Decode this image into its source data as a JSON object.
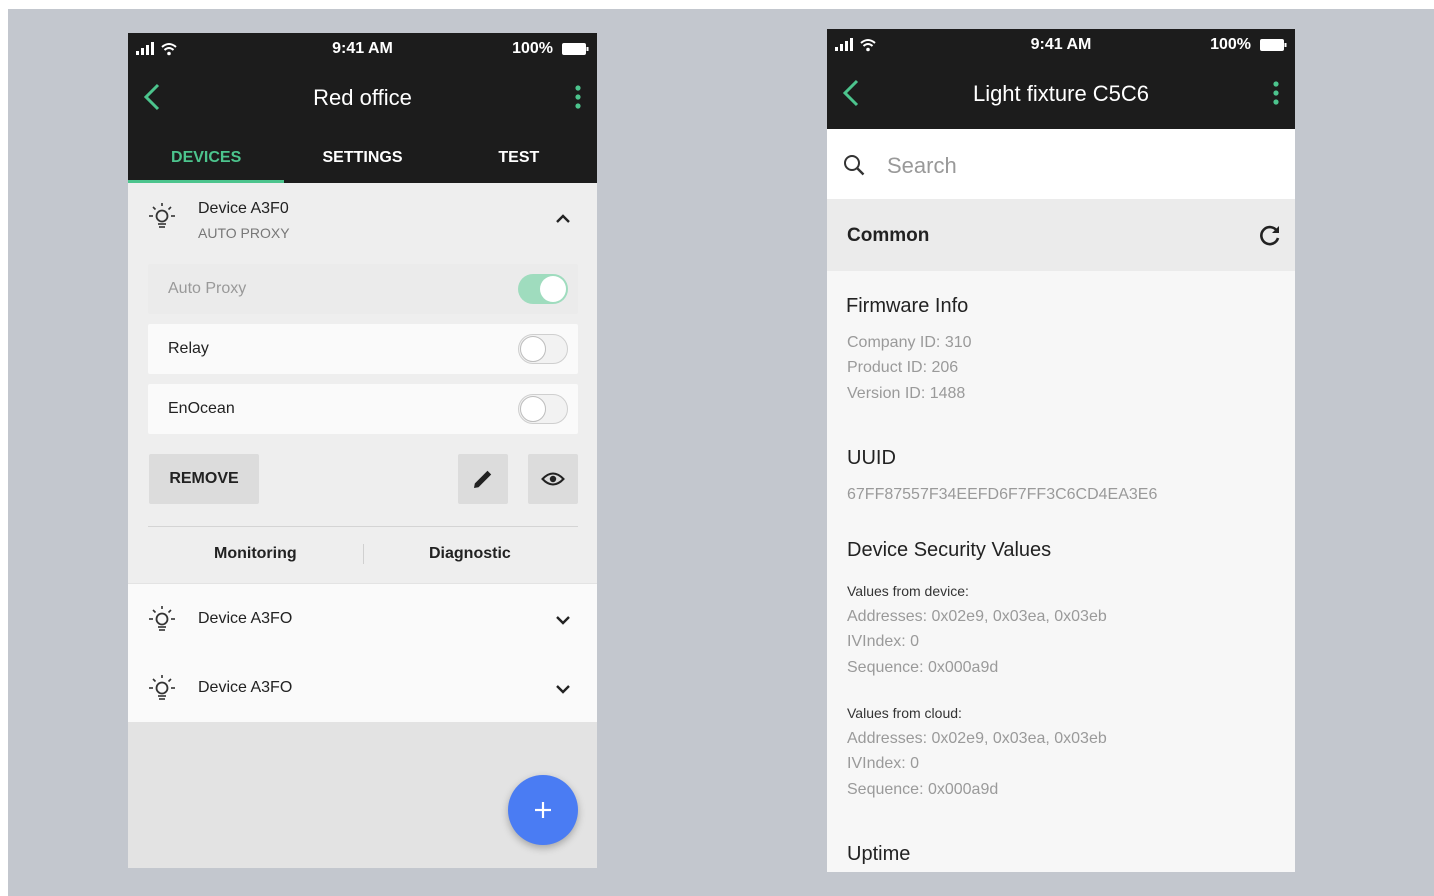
{
  "phone1": {
    "status": {
      "time": "9:41 AM",
      "battery": "100%"
    },
    "app_bar": {
      "title": "Red office"
    },
    "tabs": [
      {
        "label": "DEVICES",
        "active": true
      },
      {
        "label": "SETTINGS",
        "active": false
      },
      {
        "label": "TEST",
        "active": false
      }
    ],
    "expanded_device": {
      "name": "Device  A3F0",
      "subtitle": "AUTO PROXY",
      "toggles": [
        {
          "label": "Auto Proxy",
          "on": true,
          "disabled": true
        },
        {
          "label": "Relay",
          "on": false,
          "disabled": false
        },
        {
          "label": "EnOcean",
          "on": false,
          "disabled": false
        }
      ],
      "remove_label": "REMOVE",
      "links": {
        "monitoring": "Monitoring",
        "diagnostic": "Diagnostic"
      }
    },
    "devices": [
      {
        "name": "Device A3FO"
      },
      {
        "name": "Device A3FO"
      }
    ]
  },
  "phone2": {
    "status": {
      "time": "9:41 AM",
      "battery": "100%"
    },
    "app_bar": {
      "title": "Light fixture C5C6"
    },
    "search": {
      "placeholder": "Search"
    },
    "section": {
      "title": "Common"
    },
    "firmware": {
      "title": "Firmware Info",
      "lines": [
        "Company ID: 310",
        "Product ID: 206",
        "Version ID: 1488"
      ]
    },
    "uuid": {
      "title": "UUID",
      "value": "67FF87557F34EEFD6F7FF3C6CD4EA3E6"
    },
    "security": {
      "title": "Device Security Values",
      "device_label": "Values from device:",
      "device_lines": [
        "Addresses: 0x02e9, 0x03ea, 0x03eb",
        "IVIndex: 0",
        "Sequence: 0x000a9d"
      ],
      "cloud_label": "Values from cloud:",
      "cloud_lines": [
        "Addresses: 0x02e9, 0x03ea, 0x03eb",
        "IVIndex: 0",
        "Sequence: 0x000a9d"
      ]
    },
    "uptime": {
      "title": "Uptime"
    }
  },
  "colors": {
    "accent_green": "#4cc48d",
    "app_bar": "#1c1c1c",
    "fab_blue": "#4a7cf3",
    "background": "#c3c7ce"
  },
  "icons": [
    "signal-icon",
    "wifi-icon",
    "battery-icon",
    "back-icon",
    "more-icon",
    "bulb-icon",
    "chevron-up-icon",
    "chevron-down-icon",
    "pencil-icon",
    "eye-icon",
    "plus-icon",
    "search-icon",
    "refresh-icon"
  ]
}
